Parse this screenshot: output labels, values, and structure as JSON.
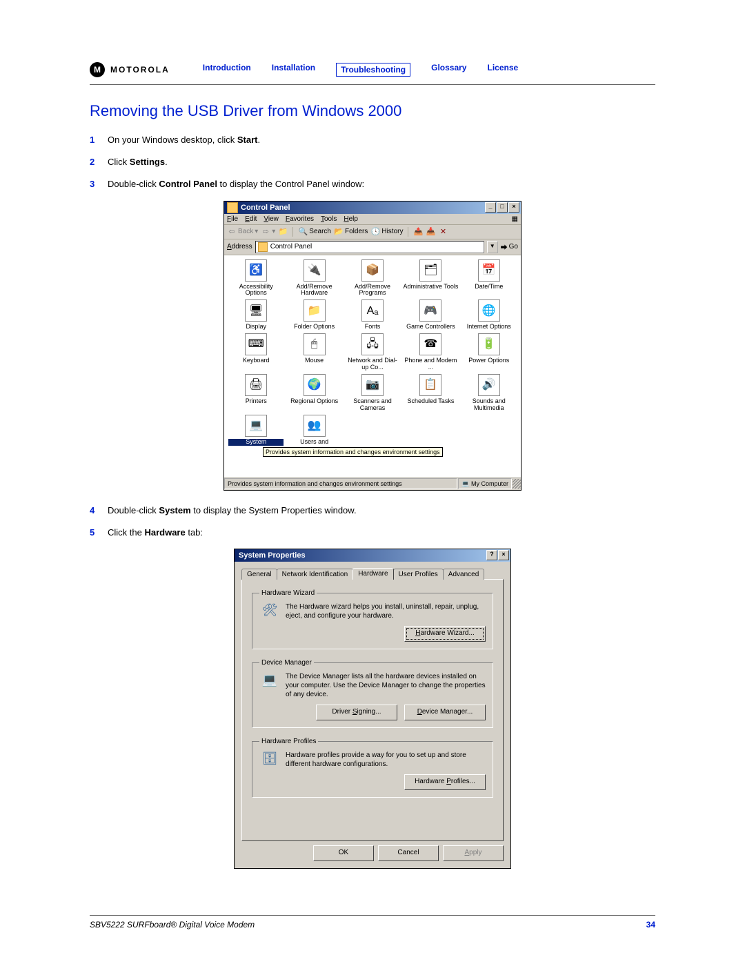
{
  "header": {
    "brand": "MOTOROLA",
    "nav": [
      "Introduction",
      "Installation",
      "Troubleshooting",
      "Glossary",
      "License"
    ],
    "nav_active": "Troubleshooting"
  },
  "title": "Removing the USB Driver from Windows 2000",
  "steps": {
    "s1": {
      "num": "1",
      "pre": "On your Windows desktop, click ",
      "bold": "Start",
      "post": "."
    },
    "s2": {
      "num": "2",
      "pre": "Click ",
      "bold": "Settings",
      "post": "."
    },
    "s3": {
      "num": "3",
      "pre": "Double-click ",
      "bold": "Control Panel",
      "post": " to display the Control Panel window:"
    },
    "s4": {
      "num": "4",
      "pre": "Double-click ",
      "bold": "System",
      "post": " to display the System Properties window."
    },
    "s5": {
      "num": "5",
      "pre": "Click the ",
      "bold": "Hardware",
      "post": " tab:"
    }
  },
  "control_panel": {
    "title": "Control Panel",
    "menu": [
      "File",
      "Edit",
      "View",
      "Favorites",
      "Tools",
      "Help"
    ],
    "toolbar": {
      "back": "Back",
      "search": "Search",
      "folders": "Folders",
      "history": "History"
    },
    "address_label": "Address",
    "address_value": "Control Panel",
    "go_label": "Go",
    "items": [
      {
        "label": "Accessibility Options",
        "glyph": "♿"
      },
      {
        "label": "Add/Remove Hardware",
        "glyph": "🔌"
      },
      {
        "label": "Add/Remove Programs",
        "glyph": "📦"
      },
      {
        "label": "Administrative Tools",
        "glyph": "🗂"
      },
      {
        "label": "Date/Time",
        "glyph": "📅"
      },
      {
        "label": "Display",
        "glyph": "🖥"
      },
      {
        "label": "Folder Options",
        "glyph": "📁"
      },
      {
        "label": "Fonts",
        "glyph": "Aₐ"
      },
      {
        "label": "Game Controllers",
        "glyph": "🎮"
      },
      {
        "label": "Internet Options",
        "glyph": "🌐"
      },
      {
        "label": "Keyboard",
        "glyph": "⌨"
      },
      {
        "label": "Mouse",
        "glyph": "🖱"
      },
      {
        "label": "Network and Dial-up Co...",
        "glyph": "🖧"
      },
      {
        "label": "Phone and Modem ...",
        "glyph": "☎"
      },
      {
        "label": "Power Options",
        "glyph": "🔋"
      },
      {
        "label": "Printers",
        "glyph": "🖨"
      },
      {
        "label": "Regional Options",
        "glyph": "🌍"
      },
      {
        "label": "Scanners and Cameras",
        "glyph": "📷"
      },
      {
        "label": "Scheduled Tasks",
        "glyph": "📋"
      },
      {
        "label": "Sounds and Multimedia",
        "glyph": "🔊"
      },
      {
        "label": "System",
        "glyph": "💻",
        "selected": true
      },
      {
        "label": "Users and",
        "glyph": "👥"
      }
    ],
    "tooltip": "Provides system information and changes environment settings",
    "status_text": "Provides system information and changes environment settings",
    "status_location": "My Computer"
  },
  "system_properties": {
    "title": "System Properties",
    "tabs": [
      "General",
      "Network Identification",
      "Hardware",
      "User Profiles",
      "Advanced"
    ],
    "active_tab": "Hardware",
    "hw_wizard": {
      "legend": "Hardware Wizard",
      "text": "The Hardware wizard helps you install, uninstall, repair, unplug, eject, and configure your hardware.",
      "button": "Hardware Wizard..."
    },
    "dev_mgr": {
      "legend": "Device Manager",
      "text": "The Device Manager lists all the hardware devices installed on your computer. Use the Device Manager to change the properties of any device.",
      "signing_btn": "Driver Signing...",
      "devmgr_btn": "Device Manager..."
    },
    "hw_profiles": {
      "legend": "Hardware Profiles",
      "text": "Hardware profiles provide a way for you to set up and store different hardware configurations.",
      "button": "Hardware Profiles..."
    },
    "dlg_buttons": {
      "ok": "OK",
      "cancel": "Cancel",
      "apply": "Apply"
    }
  },
  "footer": {
    "product": "SBV5222 SURFboard® Digital Voice Modem",
    "page": "34"
  }
}
